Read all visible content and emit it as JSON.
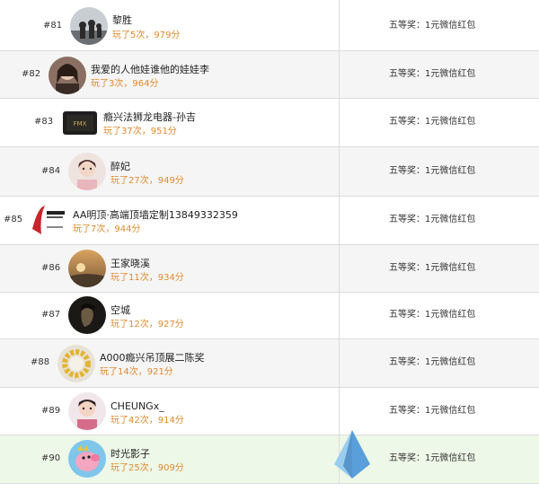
{
  "rows": [
    {
      "rank": "#81",
      "name": "黎胜",
      "score": "玩了5次，979分",
      "prize": "五等奖：1元微信红包",
      "avatar_icon": "silhouette-group-avatar"
    },
    {
      "rank": "#82",
      "name": "我爱的人他娃谁他的娃娃李",
      "score": "玩了3次，964分",
      "prize": "五等奖：1元微信红包",
      "avatar_icon": "woman-portrait-avatar"
    },
    {
      "rank": "#83",
      "name": "瘾兴法狮龙电器-孙吉",
      "score": "玩了37次，951分",
      "prize": "五等奖：1元微信红包",
      "avatar_icon": "appliance-box-avatar"
    },
    {
      "rank": "#84",
      "name": "醉妃",
      "score": "玩了27次，949分",
      "prize": "五等奖：1元微信红包",
      "avatar_icon": "girl-portrait-avatar"
    },
    {
      "rank": "#85",
      "name": "AA明顶·高端顶墙定制13849332359",
      "score": "玩了7次，944分",
      "prize": "五等奖：1元微信红包",
      "avatar_icon": "ceiling-brand-logo-avatar"
    },
    {
      "rank": "#86",
      "name": "王家晓溪",
      "score": "玩了11次，934分",
      "prize": "五等奖：1元微信红包",
      "avatar_icon": "sunset-landscape-avatar"
    },
    {
      "rank": "#87",
      "name": "空城",
      "score": "玩了12次，927分",
      "prize": "五等奖：1元微信红包",
      "avatar_icon": "dark-portrait-avatar"
    },
    {
      "rank": "#88",
      "name": "A000瘾兴吊顶展二陈奖",
      "score": "玩了14次，921分",
      "prize": "五等奖：1元微信红包",
      "avatar_icon": "flower-wreath-avatar"
    },
    {
      "rank": "#89",
      "name": "CHEUNGx_",
      "score": "玩了42次，914分",
      "prize": "五等奖：1元微信红包",
      "avatar_icon": "child-portrait-avatar"
    },
    {
      "rank": "#90",
      "name": "时光影子",
      "score": "玩了25次，909分",
      "prize": "五等奖：1元微信红包",
      "avatar_icon": "peppa-pig-avatar"
    }
  ],
  "colors": {
    "score": "#e08a2e",
    "highlight_row": "#eef8e8"
  }
}
